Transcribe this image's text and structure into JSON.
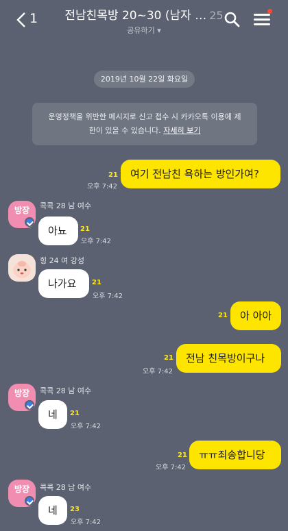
{
  "header": {
    "back_count": "1",
    "title": "전남친목방 20~30 (남자 …",
    "member_count": "25",
    "subtitle": "공유하기 ▾"
  },
  "date_divider": "2019년 10월 22일 화요일",
  "notice": {
    "line1": "운영정책을 위반한 메시지로 신고 접수 시 카카오톡 이용에 제",
    "line2_prefix": "한이 있을 수 있습니다. ",
    "link": "자세히 보기"
  },
  "messages": [
    {
      "text": "여기 전남친 욕하는 방인가여?",
      "unread": "21",
      "time": "오후 7:42"
    },
    {
      "sender": "콕콕 28 남 여수",
      "avatar": "방장",
      "text": "아뇨",
      "unread": "21",
      "time": "오후 7:42"
    },
    {
      "sender": "힝 24 여 강성",
      "text": "나가요",
      "unread": "21",
      "time": "오후 7:42"
    },
    {
      "text": "아 아아",
      "unread": "21"
    },
    {
      "text": "전남 친목방이구나",
      "unread": "21",
      "time": "오후 7:42"
    },
    {
      "sender": "콕콕 28 남 여수",
      "avatar": "방장",
      "text": "네",
      "unread": "21",
      "time": "오후 7:42"
    },
    {
      "text": "ㅠㅠ죄송합니당",
      "unread": "21",
      "time": "오후 7:42"
    },
    {
      "sender": "콕콕 28 남 여수",
      "avatar": "방장",
      "text": "네",
      "unread": "23",
      "time": "오후 7:42"
    }
  ],
  "colors": {
    "background": "#5b6170",
    "my_bubble": "#fee500",
    "other_bubble": "#ffffff",
    "unread_count": "#ffe81a",
    "host_avatar": "#f08db0",
    "host_badge": "#3d7de3"
  }
}
